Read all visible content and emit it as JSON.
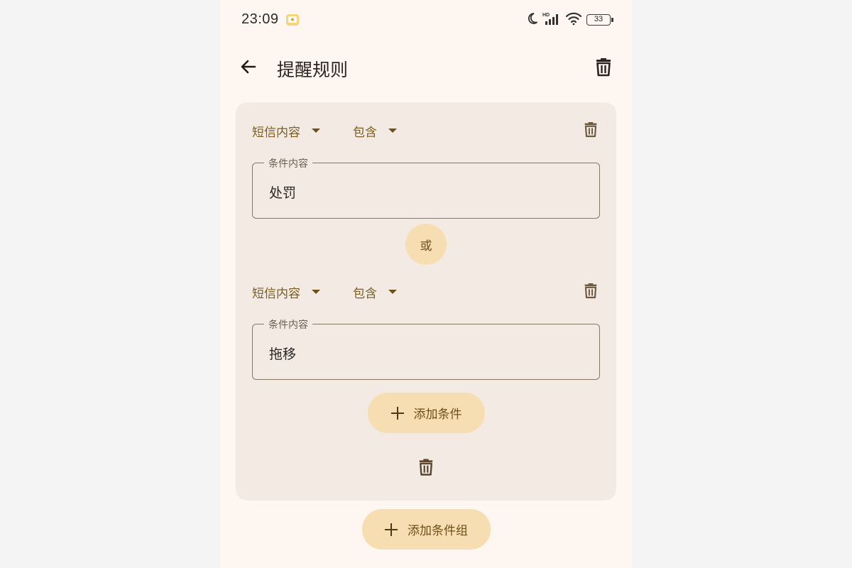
{
  "status_bar": {
    "time": "23:09",
    "battery": "33",
    "icons": [
      "notification-app-icon",
      "moon-icon",
      "hd-signal-icon",
      "wifi-icon",
      "battery-icon"
    ]
  },
  "app_bar": {
    "title": "提醒规则",
    "back_icon": "arrow-left-icon",
    "delete_icon": "trash-icon"
  },
  "condition_group": {
    "conditions": [
      {
        "field": "短信内容",
        "operator": "包含",
        "input_label": "条件内容",
        "input_value": "处罚"
      },
      {
        "field": "短信内容",
        "operator": "包含",
        "input_label": "条件内容",
        "input_value": "拖移"
      }
    ],
    "connector": "或",
    "add_condition_label": "添加条件"
  },
  "add_group_label": "添加条件组",
  "colors": {
    "page_bg": "#fef7f1",
    "card_bg": "#f3ebe3",
    "accent_button": "#f6deb2",
    "accent_text": "#7a5c1f",
    "outline": "#857766"
  }
}
